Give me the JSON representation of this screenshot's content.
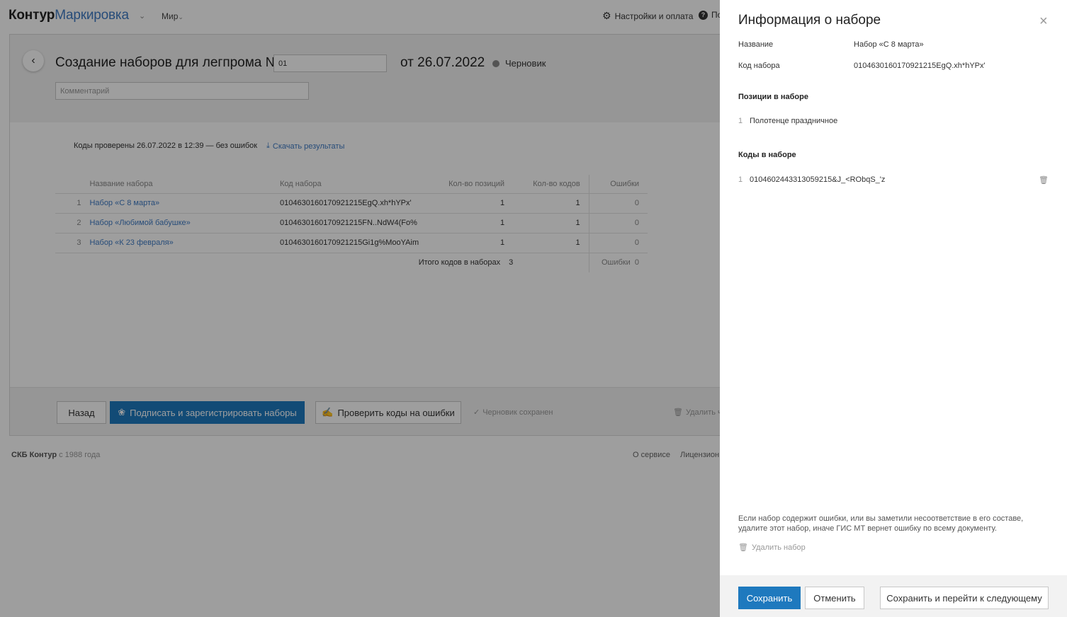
{
  "header": {
    "logo_brand": "Контур",
    "logo_product": "Маркировка",
    "org_name": "Мир",
    "settings_label": "Настройки и оплата",
    "help_label": "По"
  },
  "document": {
    "title": "Создание наборов для легпрома №",
    "number_value": "01",
    "date_label": "от 26.07.2022",
    "status": "Черновик",
    "comment_placeholder": "Комментарий"
  },
  "check": {
    "info": "Коды проверены 26.07.2022 в 12:39 — без ошибок",
    "download_label": "Скачать результаты"
  },
  "table": {
    "headers": [
      "Название набора",
      "Код набора",
      "Кол-во позиций",
      "Кол-во кодов",
      "Ошибки"
    ],
    "rows": [
      {
        "no": "1",
        "name": "Набор «С 8 марта»",
        "code": "0104630160170921215EgQ.xh*hYPx'",
        "positions": "1",
        "codes": "1",
        "errors": "0"
      },
      {
        "no": "2",
        "name": "Набор «Любимой бабушке»",
        "code": "0104630160170921215FN..NdW4(Fo%",
        "positions": "1",
        "codes": "1",
        "errors": "0"
      },
      {
        "no": "3",
        "name": "Набор «К 23 февраля»",
        "code": "0104630160170921215Gi1g%MooYAim",
        "positions": "1",
        "codes": "1",
        "errors": "0"
      }
    ],
    "total_label": "Итого кодов в наборах",
    "total_value": "3",
    "errors_label": "Ошибки",
    "errors_value": "0"
  },
  "actions": {
    "back_label": "Назад",
    "sign_label": "Подписать и зарегистрировать наборы",
    "check_label": "Проверить коды на ошибки",
    "saved_note": "Черновик сохранен",
    "delete_label": "Удалить ч"
  },
  "footer": {
    "company": "СКБ Контур",
    "since": "с 1988 года",
    "links": [
      "О сервисе",
      "Лицензион"
    ]
  },
  "panel": {
    "title": "Информация о наборе",
    "name_label": "Название",
    "name_value": "Набор «С 8 марта»",
    "code_label": "Код набора",
    "code_value": "0104630160170921215EgQ.xh*hYPx'",
    "positions_title": "Позиции в наборе",
    "positions": [
      {
        "no": "1",
        "text": "Полотенце праздничное"
      }
    ],
    "codes_title": "Коды в наборе",
    "codes": [
      {
        "no": "1",
        "text": "0104602443313059215&J_<RObqS_'z"
      }
    ],
    "note": "Если набор содержит ошибки, или вы заметили несоответствие в его составе, удалите этот набор, иначе ГИС МТ вернет ошибку по всему документу.",
    "delete_label": "Удалить набор",
    "save_label": "Сохранить",
    "cancel_label": "Отменить",
    "save_next_label": "Сохранить и перейти к следующему"
  },
  "colors": {
    "accent": "#1e79be",
    "link": "#3f7bc4",
    "overlay": "#000000"
  }
}
